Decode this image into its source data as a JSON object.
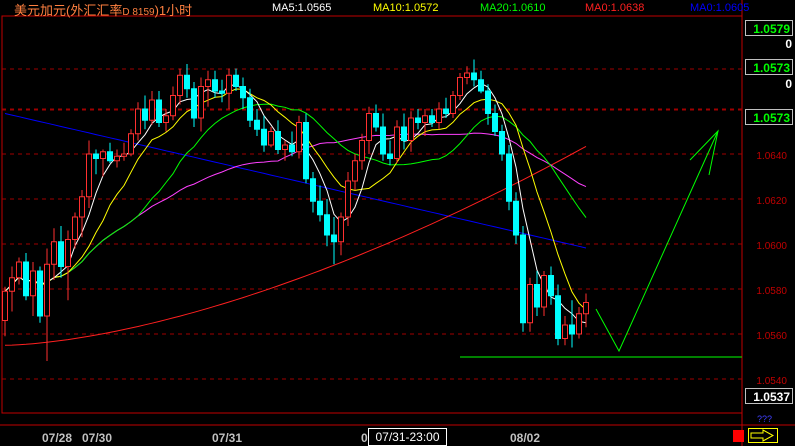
{
  "header": {
    "title": "美元加元(外汇汇率",
    "code": "D 8159",
    "period": ")1小时",
    "ma5": "MA5:1.0565",
    "ma10": "MA10:1.0572",
    "ma20": "MA20:1.0610",
    "ma0a": "MA0:1.0638",
    "ma0b": "MA0:1.0605"
  },
  "colors": {
    "title": "#ff8040",
    "ma5": "#ffffff",
    "ma10": "#ffff00",
    "ma20": "#00ff00",
    "ma0a": "#ff2020",
    "ma0b": "#0000ff",
    "up": "#ff3030",
    "down": "#00ffff",
    "grid": "#a00000",
    "price_box": "#00ff00",
    "drawing": "#00ff00"
  },
  "price_boxes": [
    {
      "label": "1.0579"
    },
    {
      "label": "1.0573"
    },
    {
      "label": "1.0573"
    },
    {
      "label": "1.0537"
    }
  ],
  "zero_labels": [
    "0",
    "0"
  ],
  "axis_ticks": [
    "1.0640",
    "1.0620",
    "1.0600",
    "1.0580",
    "1.0560",
    "1.0540"
  ],
  "date_labels": [
    "07/28",
    "07/30",
    "07/31",
    "0",
    "08/02"
  ],
  "crosshair_time": "07/31-23:00",
  "bottom_right_label": "???",
  "chart_data": {
    "type": "candlestick",
    "symbol": "美元加元",
    "interval": "1小时",
    "ylim": [
      1.053,
      1.07
    ],
    "candles": [
      [
        1.0566,
        1.0581,
        1.0559,
        1.0579
      ],
      [
        1.0579,
        1.059,
        1.057,
        1.0585
      ],
      [
        1.0585,
        1.0594,
        1.0582,
        1.0592
      ],
      [
        1.0592,
        1.0596,
        1.0575,
        1.0577
      ],
      [
        1.0577,
        1.0592,
        1.0568,
        1.0588
      ],
      [
        1.0588,
        1.059,
        1.0565,
        1.0568
      ],
      [
        1.0568,
        1.0598,
        1.0548,
        1.0591
      ],
      [
        1.0591,
        1.0607,
        1.0584,
        1.0601
      ],
      [
        1.0601,
        1.0608,
        1.0585,
        1.059
      ],
      [
        1.059,
        1.0606,
        1.0575,
        1.0602
      ],
      [
        1.0602,
        1.0614,
        1.0598,
        1.0612
      ],
      [
        1.0612,
        1.0624,
        1.0603,
        1.0621
      ],
      [
        1.0621,
        1.0646,
        1.0616,
        1.064
      ],
      [
        1.064,
        1.0642,
        1.0631,
        1.0638
      ],
      [
        1.0638,
        1.0642,
        1.063,
        1.0641
      ],
      [
        1.0641,
        1.0645,
        1.0636,
        1.0637
      ],
      [
        1.0637,
        1.0642,
        1.0634,
        1.0639
      ],
      [
        1.0639,
        1.0645,
        1.0637,
        1.064
      ],
      [
        1.064,
        1.0651,
        1.0639,
        1.0649
      ],
      [
        1.0649,
        1.0663,
        1.0646,
        1.066
      ],
      [
        1.066,
        1.0666,
        1.0651,
        1.0655
      ],
      [
        1.0655,
        1.0668,
        1.0653,
        1.0664
      ],
      [
        1.0664,
        1.0668,
        1.0652,
        1.0654
      ],
      [
        1.0654,
        1.066,
        1.065,
        1.0657
      ],
      [
        1.0657,
        1.067,
        1.0655,
        1.0666
      ],
      [
        1.0666,
        1.0678,
        1.0662,
        1.0675
      ],
      [
        1.0675,
        1.068,
        1.0665,
        1.0669
      ],
      [
        1.0669,
        1.0672,
        1.0652,
        1.0656
      ],
      [
        1.0656,
        1.0674,
        1.065,
        1.067
      ],
      [
        1.067,
        1.0677,
        1.0661,
        1.0673
      ],
      [
        1.0673,
        1.0677,
        1.0665,
        1.0668
      ],
      [
        1.0668,
        1.0673,
        1.0663,
        1.0667
      ],
      [
        1.0667,
        1.0678,
        1.066,
        1.0675
      ],
      [
        1.0675,
        1.0678,
        1.0668,
        1.067
      ],
      [
        1.067,
        1.0674,
        1.066,
        1.0665
      ],
      [
        1.0665,
        1.0669,
        1.0652,
        1.0655
      ],
      [
        1.0655,
        1.066,
        1.0648,
        1.0651
      ],
      [
        1.0651,
        1.0657,
        1.0641,
        1.0644
      ],
      [
        1.0644,
        1.0652,
        1.0643,
        1.065
      ],
      [
        1.065,
        1.0655,
        1.064,
        1.0642
      ],
      [
        1.0642,
        1.0646,
        1.0637,
        1.0644
      ],
      [
        1.0644,
        1.065,
        1.0639,
        1.0641
      ],
      [
        1.0641,
        1.0657,
        1.0638,
        1.0654
      ],
      [
        1.0654,
        1.0658,
        1.0627,
        1.0629
      ],
      [
        1.0629,
        1.0632,
        1.0614,
        1.0619
      ],
      [
        1.0619,
        1.0626,
        1.061,
        1.0613
      ],
      [
        1.0613,
        1.062,
        1.0599,
        1.0604
      ],
      [
        1.0604,
        1.0612,
        1.0591,
        1.0601
      ],
      [
        1.0601,
        1.0614,
        1.0595,
        1.0612
      ],
      [
        1.0612,
        1.0632,
        1.0608,
        1.0628
      ],
      [
        1.0628,
        1.064,
        1.0624,
        1.0637
      ],
      [
        1.0637,
        1.0649,
        1.0633,
        1.0646
      ],
      [
        1.0646,
        1.0661,
        1.064,
        1.0658
      ],
      [
        1.0658,
        1.0662,
        1.065,
        1.0652
      ],
      [
        1.0652,
        1.0658,
        1.0637,
        1.064
      ],
      [
        1.064,
        1.0646,
        1.0635,
        1.0638
      ],
      [
        1.0638,
        1.0655,
        1.0636,
        1.0652
      ],
      [
        1.0652,
        1.0658,
        1.0642,
        1.0646
      ],
      [
        1.0646,
        1.0659,
        1.0641,
        1.0656
      ],
      [
        1.0656,
        1.066,
        1.0651,
        1.0654
      ],
      [
        1.0654,
        1.066,
        1.0648,
        1.0657
      ],
      [
        1.0657,
        1.066,
        1.0652,
        1.0654
      ],
      [
        1.0654,
        1.0663,
        1.0651,
        1.066
      ],
      [
        1.066,
        1.0665,
        1.0656,
        1.0658
      ],
      [
        1.0658,
        1.0668,
        1.0656,
        1.0666
      ],
      [
        1.0666,
        1.0676,
        1.0664,
        1.0674
      ],
      [
        1.0674,
        1.0679,
        1.0671,
        1.0676
      ],
      [
        1.0676,
        1.0682,
        1.067,
        1.0673
      ],
      [
        1.0673,
        1.0677,
        1.0667,
        1.0668
      ],
      [
        1.0668,
        1.0671,
        1.0653,
        1.0658
      ],
      [
        1.0658,
        1.0662,
        1.0648,
        1.065
      ],
      [
        1.065,
        1.0653,
        1.0637,
        1.064
      ],
      [
        1.064,
        1.0644,
        1.0615,
        1.0619
      ],
      [
        1.0619,
        1.0623,
        1.06,
        1.0604
      ],
      [
        1.0604,
        1.0608,
        1.0561,
        1.0565
      ],
      [
        1.0565,
        1.0585,
        1.0561,
        1.0582
      ],
      [
        1.0582,
        1.0588,
        1.0568,
        1.0572
      ],
      [
        1.0572,
        1.0588,
        1.0568,
        1.0586
      ],
      [
        1.0586,
        1.059,
        1.0573,
        1.0577
      ],
      [
        1.0577,
        1.0582,
        1.0555,
        1.0558
      ],
      [
        1.0558,
        1.0568,
        1.0555,
        1.0564
      ],
      [
        1.0564,
        1.0575,
        1.0554,
        1.056
      ],
      [
        1.056,
        1.0572,
        1.0558,
        1.0569
      ],
      [
        1.0569,
        1.0578,
        1.0563,
        1.0574
      ]
    ]
  }
}
